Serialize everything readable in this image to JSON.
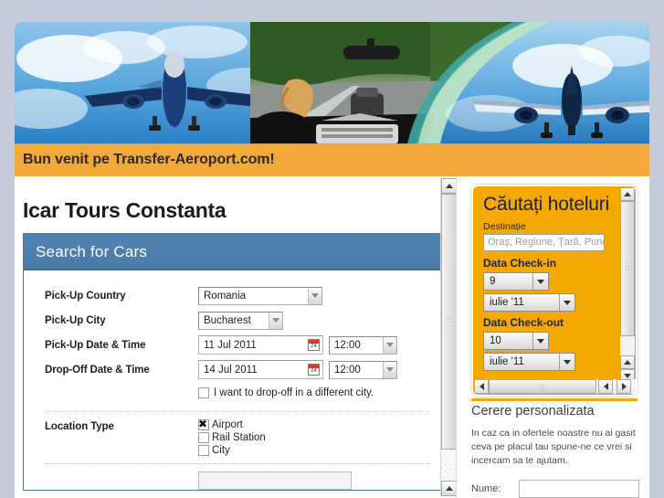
{
  "banner": {
    "alt": "airplane-and-car-travel-banner",
    "icons": [
      "airplane-icon",
      "car-interior-icon",
      "airplane-icon"
    ]
  },
  "welcome": {
    "text": "Bun venit pe Transfer-Aeroport.com!"
  },
  "main": {
    "page_title": "Icar Tours Constanta",
    "search_box": {
      "header": "Search for Cars",
      "fields": [
        {
          "label": "Pick-Up Country",
          "value": "Romania",
          "kind": "select"
        },
        {
          "label": "Pick-Up City",
          "value": "Bucharest",
          "kind": "select"
        },
        {
          "label": "Pick-Up Date & Time",
          "value": "11 Jul 2011",
          "time": "12:00",
          "kind": "date"
        },
        {
          "label": "Drop-Off Date & Time",
          "value": "14 Jul 2011",
          "time": "12:00",
          "kind": "date"
        }
      ],
      "different_city": {
        "label": "I want to drop-off in a different city.",
        "checked": false
      },
      "location_type": {
        "label": "Location Type",
        "options": [
          {
            "label": "Airport",
            "checked": true
          },
          {
            "label": "Rail Station",
            "checked": false
          },
          {
            "label": "City",
            "checked": false
          }
        ]
      }
    }
  },
  "sidebar": {
    "hotel_widget": {
      "title": "Căutați hoteluri",
      "destination_label": "Destinație",
      "destination_placeholder": "Oraş, Regiune, Ţară, Punc",
      "checkin_label": "Data Check-in",
      "checkin_day": "9",
      "checkin_month": "iulie '11",
      "checkout_label": "Data Check-out",
      "checkout_day": "10",
      "checkout_month": "iulie '11"
    },
    "cerere": {
      "title": "Cerere personalizata",
      "text": "In caz ca in ofertele noastre nu ai gasit ceva pe placul tau spune-ne ce vrei si incercam sa te ajutam.",
      "name_label": "Nume:",
      "name_value": ""
    }
  },
  "colors": {
    "page_background": "#c3ccd8",
    "banner_blue": "#1f7ec4",
    "welcome_orange": "#f3a937",
    "search_header_blue": "#4a7aa7",
    "hotel_widget_orange": "#f5a800",
    "hotel_title_navy": "#16214a"
  }
}
